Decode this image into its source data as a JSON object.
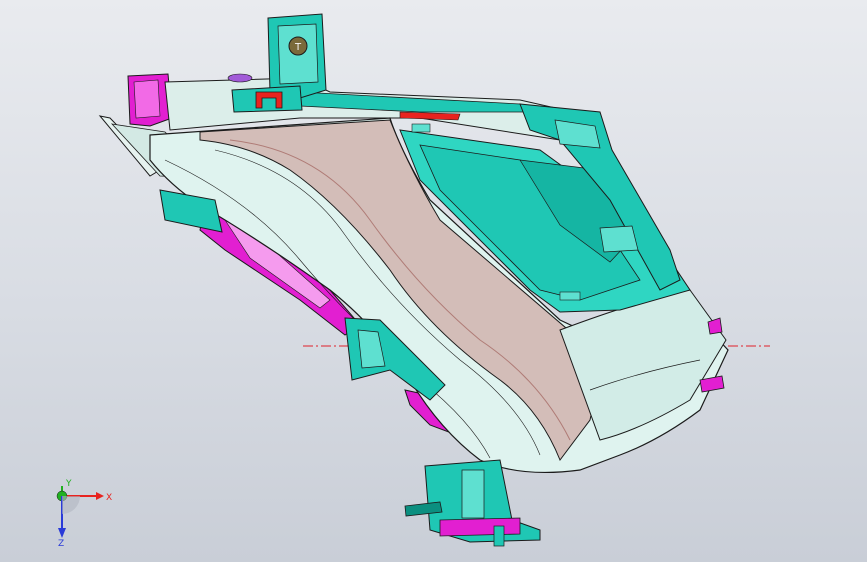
{
  "viewport": {
    "background_top": "#e9ebef",
    "background_bottom": "#c9ced7"
  },
  "model": {
    "tab_letter": "T",
    "colors": {
      "body_light": "#dff3ef",
      "body_mid": "#c9e6e2",
      "lens_band": "#c98f8a",
      "teal": "#1fc7b4",
      "teal_dark": "#0b8f80",
      "magenta": "#e21fd1",
      "red": "#e8231f",
      "outline": "#1b1b1b",
      "centerline": "#e0202a"
    }
  },
  "triad": {
    "x_label": "X",
    "y_label": "Y",
    "z_label": "Z"
  }
}
